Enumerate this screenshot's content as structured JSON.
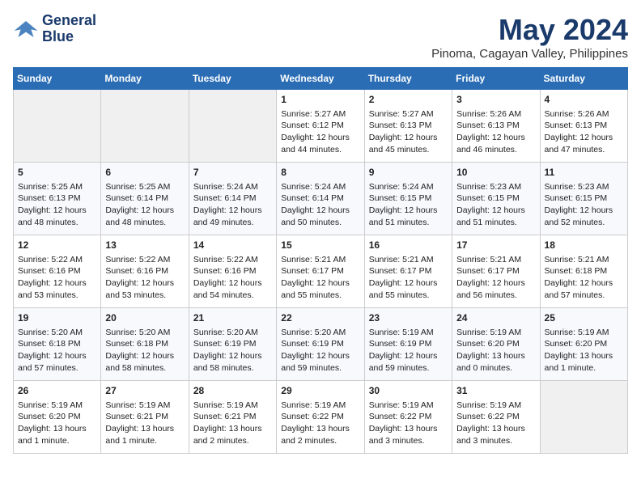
{
  "header": {
    "logo_line1": "General",
    "logo_line2": "Blue",
    "title": "May 2024",
    "subtitle": "Pinoma, Cagayan Valley, Philippines"
  },
  "weekdays": [
    "Sunday",
    "Monday",
    "Tuesday",
    "Wednesday",
    "Thursday",
    "Friday",
    "Saturday"
  ],
  "weeks": [
    [
      {
        "day": "",
        "info": ""
      },
      {
        "day": "",
        "info": ""
      },
      {
        "day": "",
        "info": ""
      },
      {
        "day": "1",
        "info": "Sunrise: 5:27 AM\nSunset: 6:12 PM\nDaylight: 12 hours\nand 44 minutes."
      },
      {
        "day": "2",
        "info": "Sunrise: 5:27 AM\nSunset: 6:13 PM\nDaylight: 12 hours\nand 45 minutes."
      },
      {
        "day": "3",
        "info": "Sunrise: 5:26 AM\nSunset: 6:13 PM\nDaylight: 12 hours\nand 46 minutes."
      },
      {
        "day": "4",
        "info": "Sunrise: 5:26 AM\nSunset: 6:13 PM\nDaylight: 12 hours\nand 47 minutes."
      }
    ],
    [
      {
        "day": "5",
        "info": "Sunrise: 5:25 AM\nSunset: 6:13 PM\nDaylight: 12 hours\nand 48 minutes."
      },
      {
        "day": "6",
        "info": "Sunrise: 5:25 AM\nSunset: 6:14 PM\nDaylight: 12 hours\nand 48 minutes."
      },
      {
        "day": "7",
        "info": "Sunrise: 5:24 AM\nSunset: 6:14 PM\nDaylight: 12 hours\nand 49 minutes."
      },
      {
        "day": "8",
        "info": "Sunrise: 5:24 AM\nSunset: 6:14 PM\nDaylight: 12 hours\nand 50 minutes."
      },
      {
        "day": "9",
        "info": "Sunrise: 5:24 AM\nSunset: 6:15 PM\nDaylight: 12 hours\nand 51 minutes."
      },
      {
        "day": "10",
        "info": "Sunrise: 5:23 AM\nSunset: 6:15 PM\nDaylight: 12 hours\nand 51 minutes."
      },
      {
        "day": "11",
        "info": "Sunrise: 5:23 AM\nSunset: 6:15 PM\nDaylight: 12 hours\nand 52 minutes."
      }
    ],
    [
      {
        "day": "12",
        "info": "Sunrise: 5:22 AM\nSunset: 6:16 PM\nDaylight: 12 hours\nand 53 minutes."
      },
      {
        "day": "13",
        "info": "Sunrise: 5:22 AM\nSunset: 6:16 PM\nDaylight: 12 hours\nand 53 minutes."
      },
      {
        "day": "14",
        "info": "Sunrise: 5:22 AM\nSunset: 6:16 PM\nDaylight: 12 hours\nand 54 minutes."
      },
      {
        "day": "15",
        "info": "Sunrise: 5:21 AM\nSunset: 6:17 PM\nDaylight: 12 hours\nand 55 minutes."
      },
      {
        "day": "16",
        "info": "Sunrise: 5:21 AM\nSunset: 6:17 PM\nDaylight: 12 hours\nand 55 minutes."
      },
      {
        "day": "17",
        "info": "Sunrise: 5:21 AM\nSunset: 6:17 PM\nDaylight: 12 hours\nand 56 minutes."
      },
      {
        "day": "18",
        "info": "Sunrise: 5:21 AM\nSunset: 6:18 PM\nDaylight: 12 hours\nand 57 minutes."
      }
    ],
    [
      {
        "day": "19",
        "info": "Sunrise: 5:20 AM\nSunset: 6:18 PM\nDaylight: 12 hours\nand 57 minutes."
      },
      {
        "day": "20",
        "info": "Sunrise: 5:20 AM\nSunset: 6:18 PM\nDaylight: 12 hours\nand 58 minutes."
      },
      {
        "day": "21",
        "info": "Sunrise: 5:20 AM\nSunset: 6:19 PM\nDaylight: 12 hours\nand 58 minutes."
      },
      {
        "day": "22",
        "info": "Sunrise: 5:20 AM\nSunset: 6:19 PM\nDaylight: 12 hours\nand 59 minutes."
      },
      {
        "day": "23",
        "info": "Sunrise: 5:19 AM\nSunset: 6:19 PM\nDaylight: 12 hours\nand 59 minutes."
      },
      {
        "day": "24",
        "info": "Sunrise: 5:19 AM\nSunset: 6:20 PM\nDaylight: 13 hours\nand 0 minutes."
      },
      {
        "day": "25",
        "info": "Sunrise: 5:19 AM\nSunset: 6:20 PM\nDaylight: 13 hours\nand 1 minute."
      }
    ],
    [
      {
        "day": "26",
        "info": "Sunrise: 5:19 AM\nSunset: 6:20 PM\nDaylight: 13 hours\nand 1 minute."
      },
      {
        "day": "27",
        "info": "Sunrise: 5:19 AM\nSunset: 6:21 PM\nDaylight: 13 hours\nand 1 minute."
      },
      {
        "day": "28",
        "info": "Sunrise: 5:19 AM\nSunset: 6:21 PM\nDaylight: 13 hours\nand 2 minutes."
      },
      {
        "day": "29",
        "info": "Sunrise: 5:19 AM\nSunset: 6:22 PM\nDaylight: 13 hours\nand 2 minutes."
      },
      {
        "day": "30",
        "info": "Sunrise: 5:19 AM\nSunset: 6:22 PM\nDaylight: 13 hours\nand 3 minutes."
      },
      {
        "day": "31",
        "info": "Sunrise: 5:19 AM\nSunset: 6:22 PM\nDaylight: 13 hours\nand 3 minutes."
      },
      {
        "day": "",
        "info": ""
      }
    ]
  ]
}
